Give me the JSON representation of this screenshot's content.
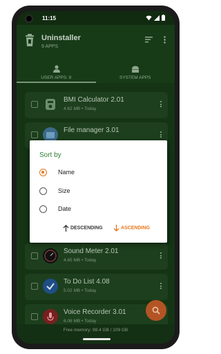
{
  "status_bar": {
    "time": "11:15"
  },
  "app": {
    "title": "Uninstaller",
    "subtitle": "9 APPS"
  },
  "tabs": [
    {
      "label": "USER APPS: 9",
      "selected": true
    },
    {
      "label": "SYSTEM APPS",
      "selected": false
    }
  ],
  "apps": [
    {
      "name": "BMI Calculator 2.01",
      "meta": "4.62 MB  •  Today",
      "icon": "bmi-calculator-icon"
    },
    {
      "name": "File manager 3.01",
      "meta": "",
      "icon": "file-manager-icon"
    },
    {
      "name": "Sound Meter 2.01",
      "meta": "4.65 MB  •  Today",
      "icon": "sound-meter-icon"
    },
    {
      "name": "To Do List 4.08",
      "meta": "5.02 MB  •  Today",
      "icon": "todo-list-icon"
    },
    {
      "name": "Voice Recorder 3.01",
      "meta": "6.06 MB  •  Today",
      "icon": "voice-recorder-icon"
    }
  ],
  "footer": {
    "free_memory": "Free memory: 98.4 GB / 109 GB"
  },
  "dialog": {
    "title": "Sort by",
    "options": [
      {
        "label": "Name",
        "selected": true
      },
      {
        "label": "Size",
        "selected": false
      },
      {
        "label": "Date",
        "selected": false
      }
    ],
    "descending_label": "DESCENDING",
    "ascending_label": "ASCENDING"
  },
  "colors": {
    "accent": "#e8751a",
    "dialog_title": "#2e7d32",
    "fab": "#b45424"
  }
}
